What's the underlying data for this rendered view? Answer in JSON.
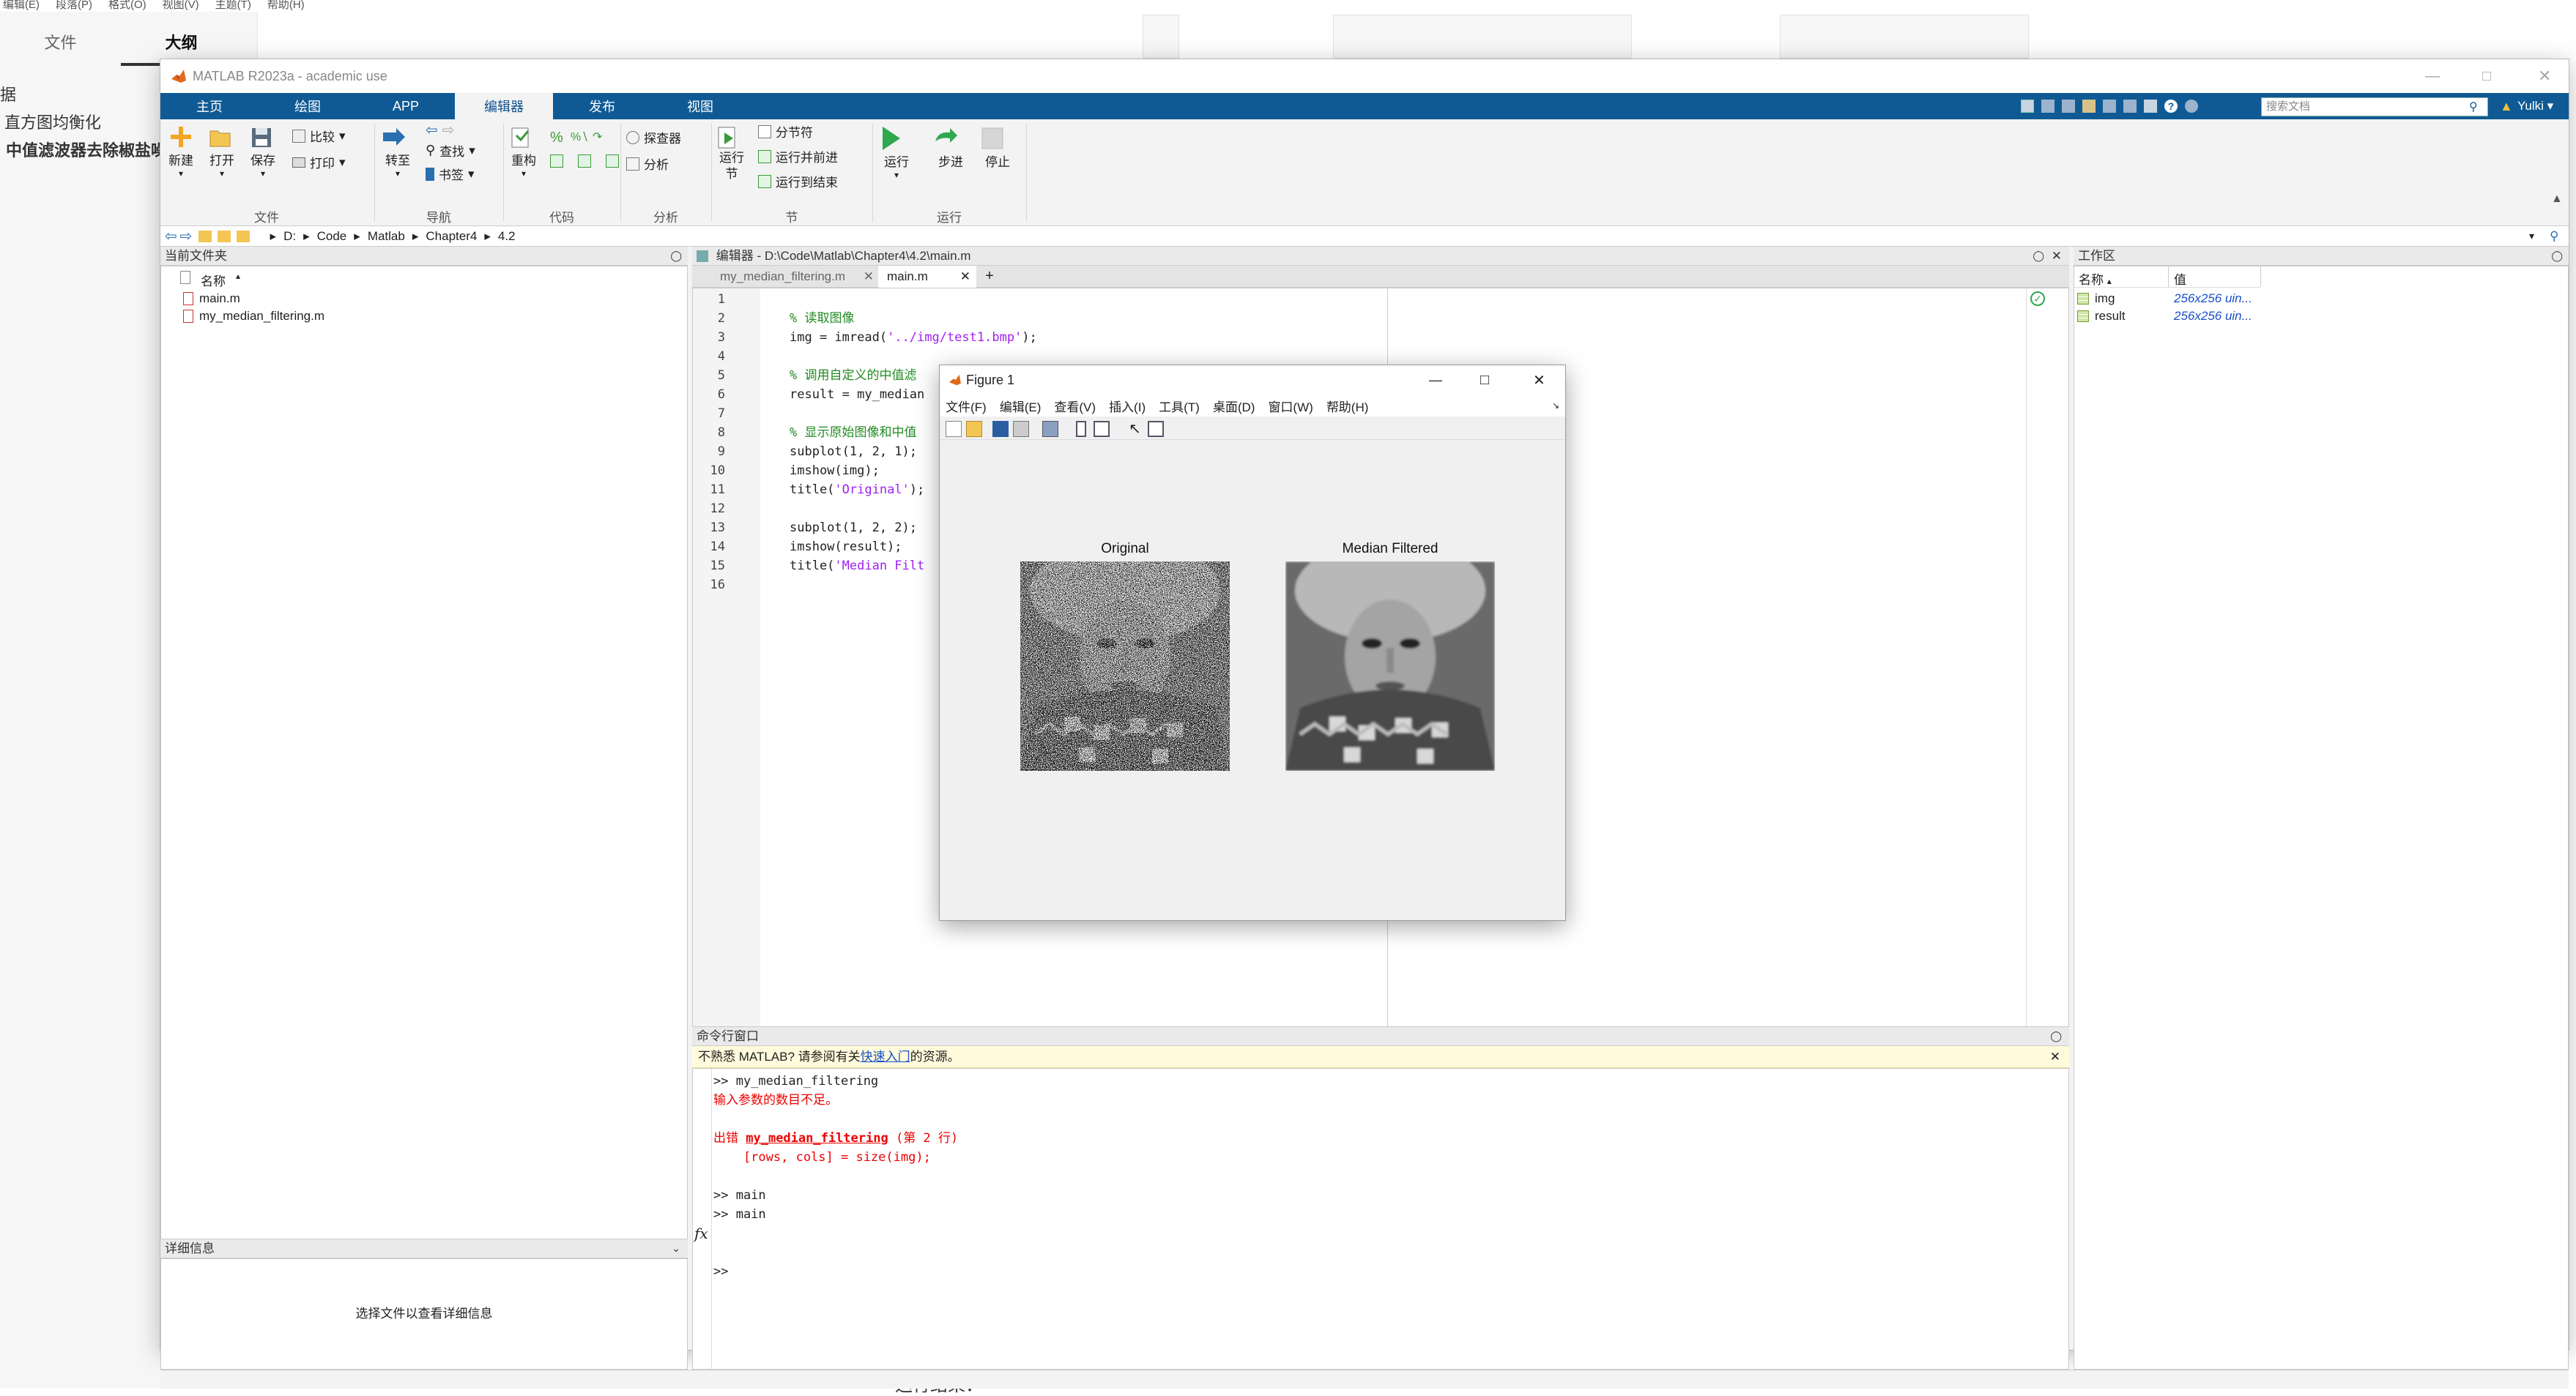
{
  "background_app": {
    "menu": [
      "编辑(E)",
      "段落(P)",
      "格式(O)",
      "视图(V)",
      "主题(T)",
      "帮助(H)"
    ],
    "tabs": {
      "file": "文件",
      "outline": "大纲"
    },
    "outline": [
      "据",
      "直方图均衡化",
      "中值滤波器去除椒盐噪"
    ],
    "content_text": "运行结果："
  },
  "matlab": {
    "title": "MATLAB R2023a - academic use",
    "ribbon_tabs": [
      "主页",
      "绘图",
      "APP",
      "编辑器",
      "发布",
      "视图"
    ],
    "active_tab": "编辑器",
    "search_placeholder": "搜索文档",
    "user": "Yulki",
    "ribbon": {
      "new": "新建",
      "open": "打开",
      "save": "保存",
      "compare": "比较",
      "print": "打印",
      "goto": "转至",
      "find": "查找",
      "bookmark": "书签",
      "refactor": "重构",
      "profiler": "探查器",
      "analyze": "分析",
      "run_section": "运行节",
      "section_break": "分节符",
      "run_and_advance": "运行并前进",
      "run_to_end": "运行到结束",
      "run": "运行",
      "step": "步进",
      "stop": "停止",
      "groups": [
        "文件",
        "导航",
        "代码",
        "分析",
        "节",
        "运行"
      ]
    },
    "address": [
      "D:",
      "Code",
      "Matlab",
      "Chapter4",
      "4.2"
    ],
    "current_folder": {
      "title": "当前文件夹",
      "column": "名称",
      "files": [
        "main.m",
        "my_median_filtering.m"
      ]
    },
    "details": {
      "title": "详细信息",
      "message": "选择文件以查看详细信息"
    },
    "editor": {
      "title": "编辑器 - D:\\Code\\Matlab\\Chapter4\\4.2\\main.m",
      "tabs": [
        "my_median_filtering.m",
        "main.m"
      ],
      "add_tab": "+",
      "line_numbers": [
        "1",
        "2",
        "3",
        "4",
        "5",
        "6",
        "7",
        "8",
        "9",
        "10",
        "11",
        "12",
        "13",
        "14",
        "15",
        "16"
      ],
      "lines": [
        {
          "cls": "",
          "text": ""
        },
        {
          "cls": "cmt",
          "text": "% 读取图像"
        },
        {
          "cls": "",
          "pre": "img = imread(",
          "str": "'../img/test1.bmp'",
          "post": ");"
        },
        {
          "cls": "",
          "text": ""
        },
        {
          "cls": "cmt",
          "text": "% 调用自定义的中值滤"
        },
        {
          "cls": "",
          "text": "result = my_median"
        },
        {
          "cls": "",
          "text": ""
        },
        {
          "cls": "cmt",
          "text": "% 显示原始图像和中值"
        },
        {
          "cls": "",
          "text": "subplot(1, 2, 1);"
        },
        {
          "cls": "",
          "text": "imshow(img);"
        },
        {
          "cls": "",
          "pre": "title(",
          "str": "'Original'",
          "post": ");"
        },
        {
          "cls": "",
          "text": ""
        },
        {
          "cls": "",
          "text": "subplot(1, 2, 2);"
        },
        {
          "cls": "",
          "text": "imshow(result);"
        },
        {
          "cls": "",
          "pre": "title(",
          "str": "'Median Filt",
          "post": ""
        },
        {
          "cls": "",
          "text": ""
        }
      ]
    },
    "command_window": {
      "title": "命令行窗口",
      "banner_pre": "不熟悉 MATLAB? 请参阅有关",
      "banner_link": "快速入门",
      "banner_post": "的资源。",
      "lines": [
        {
          "cls": "",
          "text": ">> my_median_filtering"
        },
        {
          "cls": "err",
          "text": "输入参数的数目不足。"
        },
        {
          "cls": "",
          "text": ""
        },
        {
          "cls": "err",
          "pre": "出错 ",
          "bold": "my_median_filtering",
          "post": " (第 2 行)"
        },
        {
          "cls": "err",
          "text": "    [rows, cols] = size(img);"
        },
        {
          "cls": "",
          "text": ""
        },
        {
          "cls": "",
          "text": ">> main"
        },
        {
          "cls": "",
          "text": ">> main"
        }
      ],
      "prompt": ">>",
      "fx": "fx"
    },
    "workspace": {
      "title": "工作区",
      "columns": [
        "名称",
        "值"
      ],
      "vars": [
        {
          "name": "img",
          "value": "256x256 uin..."
        },
        {
          "name": "result",
          "value": "256x256 uin..."
        }
      ]
    }
  },
  "figure": {
    "title": "Figure 1",
    "menu": [
      "文件(F)",
      "编辑(E)",
      "查看(V)",
      "插入(I)",
      "工具(T)",
      "桌面(D)",
      "窗口(W)",
      "帮助(H)"
    ],
    "axes_titles": [
      "Original",
      "Median Filtered"
    ]
  },
  "colors": {
    "matlab_blue": "#0f5a94",
    "active_tab_text": "#0f4f8a",
    "comment": "#228b22",
    "string": "#a020f0",
    "error": "#e00000"
  }
}
